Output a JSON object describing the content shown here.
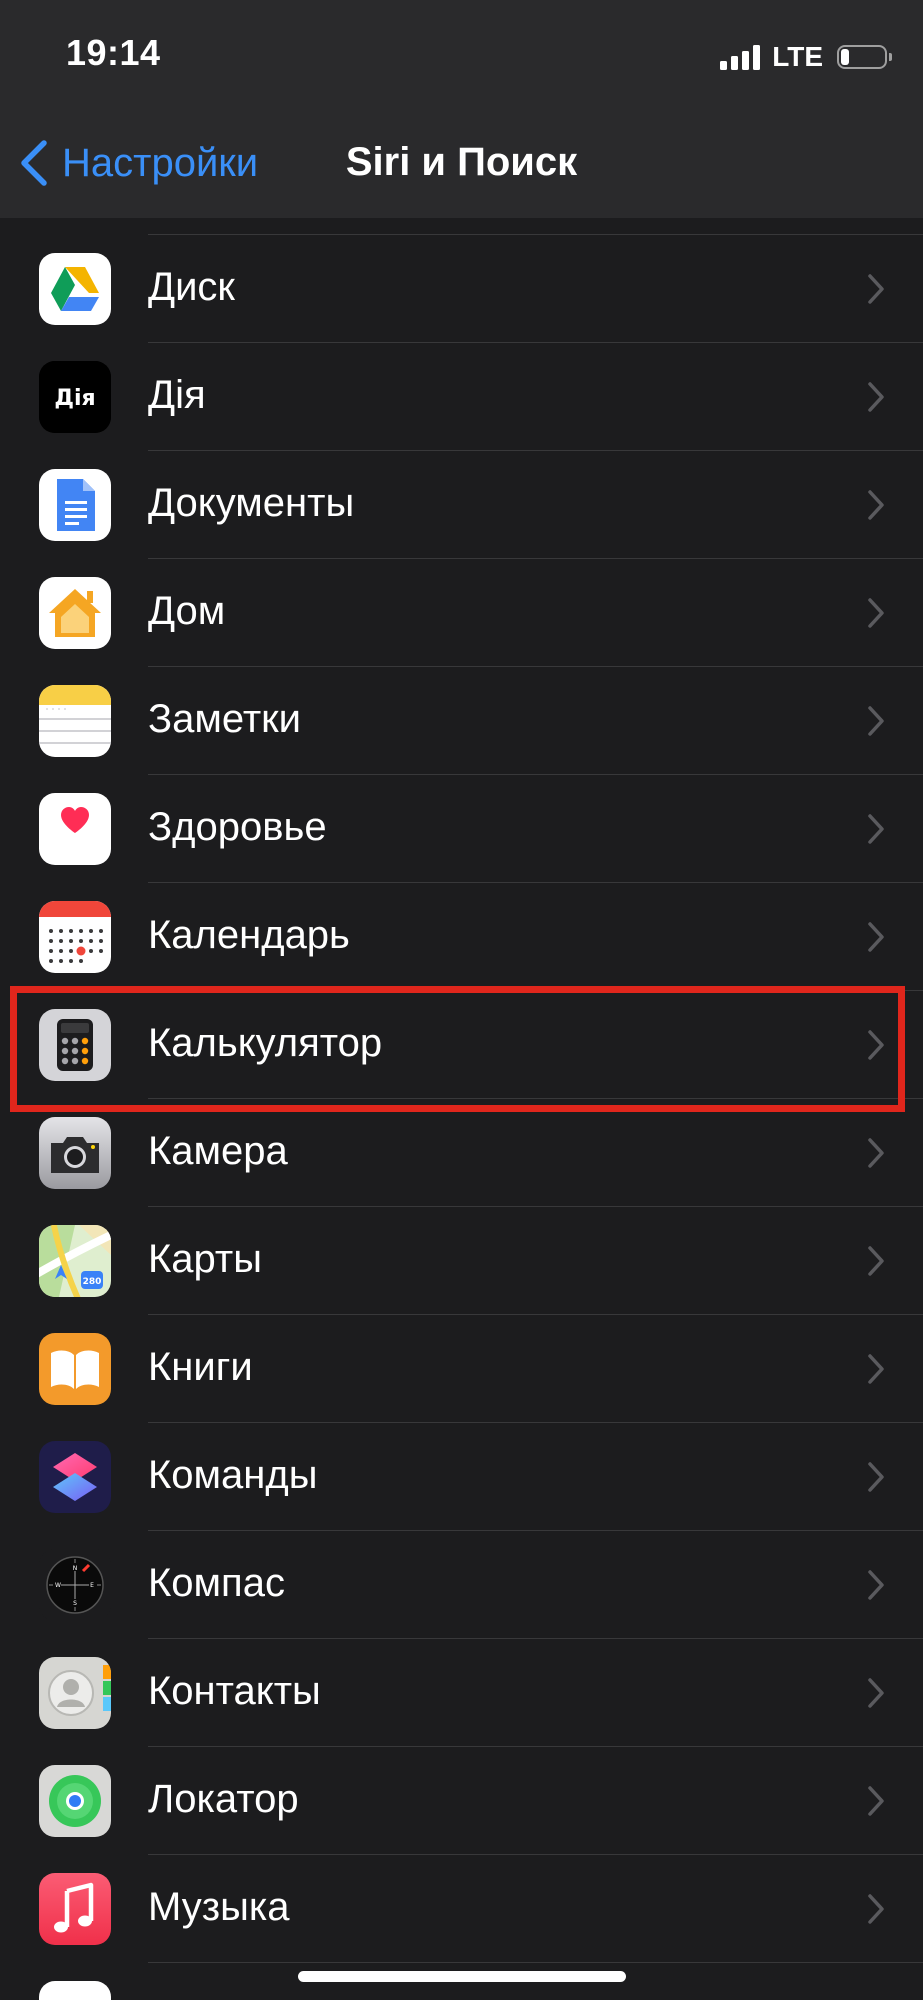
{
  "status_bar": {
    "time": "19:14",
    "network": "LTE",
    "battery_level": 0.2
  },
  "nav": {
    "back_label": "Настройки",
    "title": "Siri и Поиск"
  },
  "colors": {
    "accent": "#3a8ff7",
    "background": "#1c1c1e",
    "highlight": "#e0261c"
  },
  "apps": [
    {
      "label": "Диск",
      "icon": "google-drive-icon"
    },
    {
      "label": "Дія",
      "icon": "diia-icon",
      "icon_text": "Дія"
    },
    {
      "label": "Документы",
      "icon": "google-docs-icon"
    },
    {
      "label": "Дом",
      "icon": "home-icon"
    },
    {
      "label": "Заметки",
      "icon": "notes-icon"
    },
    {
      "label": "Здоровье",
      "icon": "health-icon"
    },
    {
      "label": "Календарь",
      "icon": "calendar-icon"
    },
    {
      "label": "Калькулятор",
      "icon": "calculator-icon",
      "highlighted": true
    },
    {
      "label": "Камера",
      "icon": "camera-icon"
    },
    {
      "label": "Карты",
      "icon": "maps-icon",
      "icon_text": "280"
    },
    {
      "label": "Книги",
      "icon": "books-icon"
    },
    {
      "label": "Команды",
      "icon": "shortcuts-icon"
    },
    {
      "label": "Компас",
      "icon": "compass-icon",
      "icon_letters": [
        "N",
        "E",
        "S",
        "W"
      ]
    },
    {
      "label": "Контакты",
      "icon": "contacts-icon"
    },
    {
      "label": "Локатор",
      "icon": "find-my-icon"
    },
    {
      "label": "Музыка",
      "icon": "music-icon"
    }
  ]
}
